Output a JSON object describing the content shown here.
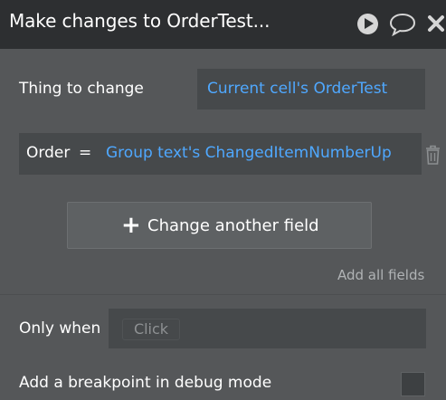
{
  "window": {
    "title": "Make changes to OrderTest...",
    "icons": [
      "play-icon",
      "comment-icon",
      "close-icon"
    ]
  },
  "thing_to_change": {
    "label": "Thing to change",
    "value": "Current cell's OrderTest"
  },
  "field_row": {
    "field_name": "Order",
    "operator": "=",
    "value": "Group text's ChangedItemNumberUp",
    "icon": "trash-icon"
  },
  "change_another_field": {
    "icon": "plus-icon",
    "label": "Change another field"
  },
  "add_all_fields": {
    "label": "Add all fields"
  },
  "only_when": {
    "label": "Only when",
    "placeholder": "Click"
  },
  "breakpoint": {
    "label": "Add a breakpoint in debug mode",
    "checked": false
  },
  "colors": {
    "panel_bg": "#555759",
    "titlebar_bg": "#2d2f31",
    "field_bg": "#46494b",
    "link_blue": "#4fa8ff"
  }
}
